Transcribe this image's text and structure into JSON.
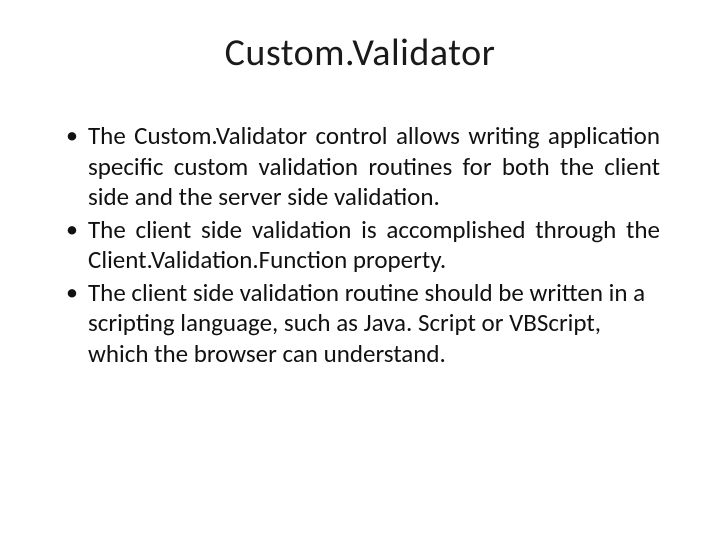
{
  "title": "Custom.Validator",
  "bullets": [
    "The Custom.Validator control allows writing application specific custom validation routines for both the client side and the server side validation.",
    "The client side validation is accomplished through the Client.Validation.Function property.",
    "The client side validation routine should be written in a scripting language, such as Java. Script or VBScript, which the browser can understand."
  ]
}
